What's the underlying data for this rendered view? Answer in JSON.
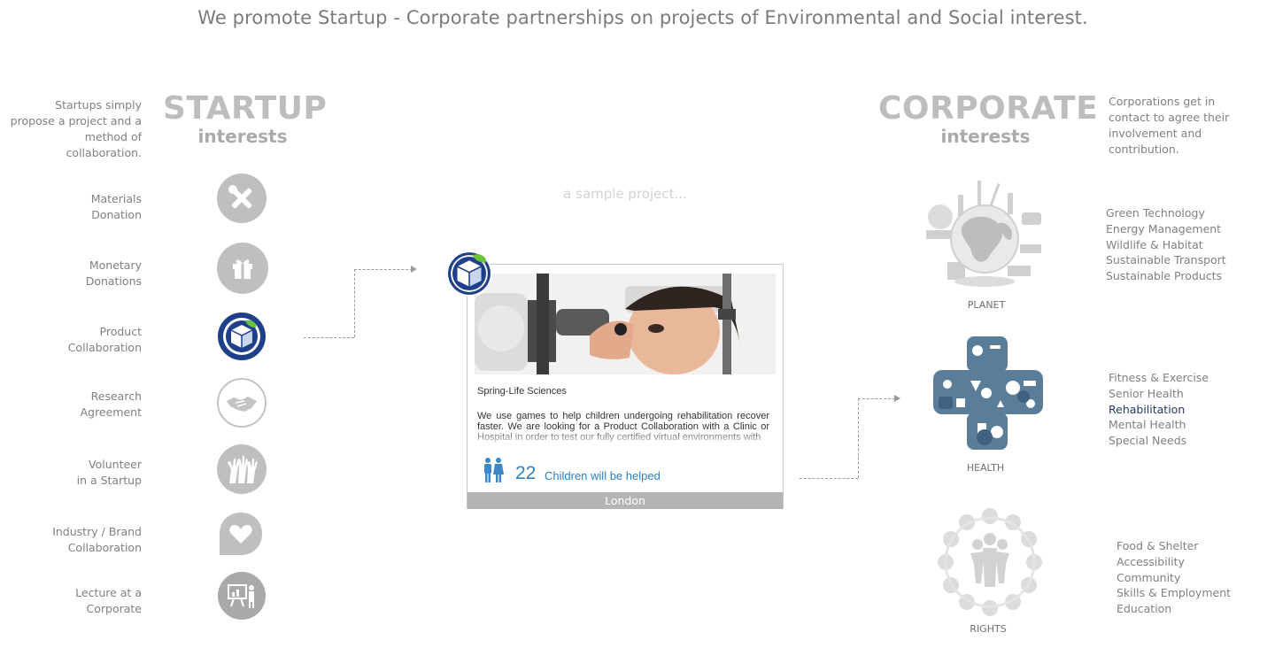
{
  "headline": "We promote Startup - Corporate partnerships on projects of Environmental and Social interest.",
  "startup": {
    "title": "STARTUP",
    "subtitle": "interests",
    "intro": "Startups simply propose a project and a method of collaboration.",
    "items": [
      {
        "label_1": "Materials",
        "label_2": "Donation",
        "icon": "tools-icon"
      },
      {
        "label_1": "Monetary",
        "label_2": "Donations",
        "icon": "gift-icon"
      },
      {
        "label_1": "Product",
        "label_2": "Collaboration",
        "icon": "box-cube-icon"
      },
      {
        "label_1": "Research",
        "label_2": "Agreement",
        "icon": "handshake-icon"
      },
      {
        "label_1": "Volunteer",
        "label_2": "in a Startup",
        "icon": "raised-hands-icon"
      },
      {
        "label_1": "Industry / Brand",
        "label_2": "Collaboration",
        "icon": "heart-bubble-icon"
      },
      {
        "label_1": "Lecture at a",
        "label_2": "Corporate",
        "icon": "presentation-icon"
      }
    ]
  },
  "corporate": {
    "title": "CORPORATE",
    "subtitle": "interests",
    "intro": "Corporations get in contact to agree their involvement and contribution.",
    "categories": [
      {
        "label": "PLANET",
        "icon": "globe-icon",
        "items": [
          "Green Technology",
          "Energy Management",
          "Wildlife & Habitat",
          "Sustainable Transport",
          "Sustainable Products"
        ]
      },
      {
        "label": "HEALTH",
        "icon": "health-cross-icon",
        "items": [
          "Fitness & Exercise",
          "Senior Health",
          "Rehabilitation",
          "Mental Health",
          "Special Needs"
        ],
        "highlighted": "Rehabilitation"
      },
      {
        "label": "RIGHTS",
        "icon": "people-circle-icon",
        "items": [
          "Food & Shelter",
          "Accessibility",
          "Community",
          "Skills & Employment",
          "Education"
        ]
      }
    ]
  },
  "sample": {
    "caption": "a sample project...",
    "company": "Spring-Life Sciences",
    "description": "We use games to help children undergoing rehabilitation recover faster. We are looking for a Product Collaboration with a Clinic or Hospital in order to test our fully certified virtual environments with",
    "count": "22",
    "count_label": "Children will be helped",
    "location": "London"
  },
  "colors": {
    "highlight": "#1f3a63",
    "count_blue": "#2a7fc4",
    "health_blue": "#5a7d9a",
    "icon_grey": "#bfbfbf"
  }
}
